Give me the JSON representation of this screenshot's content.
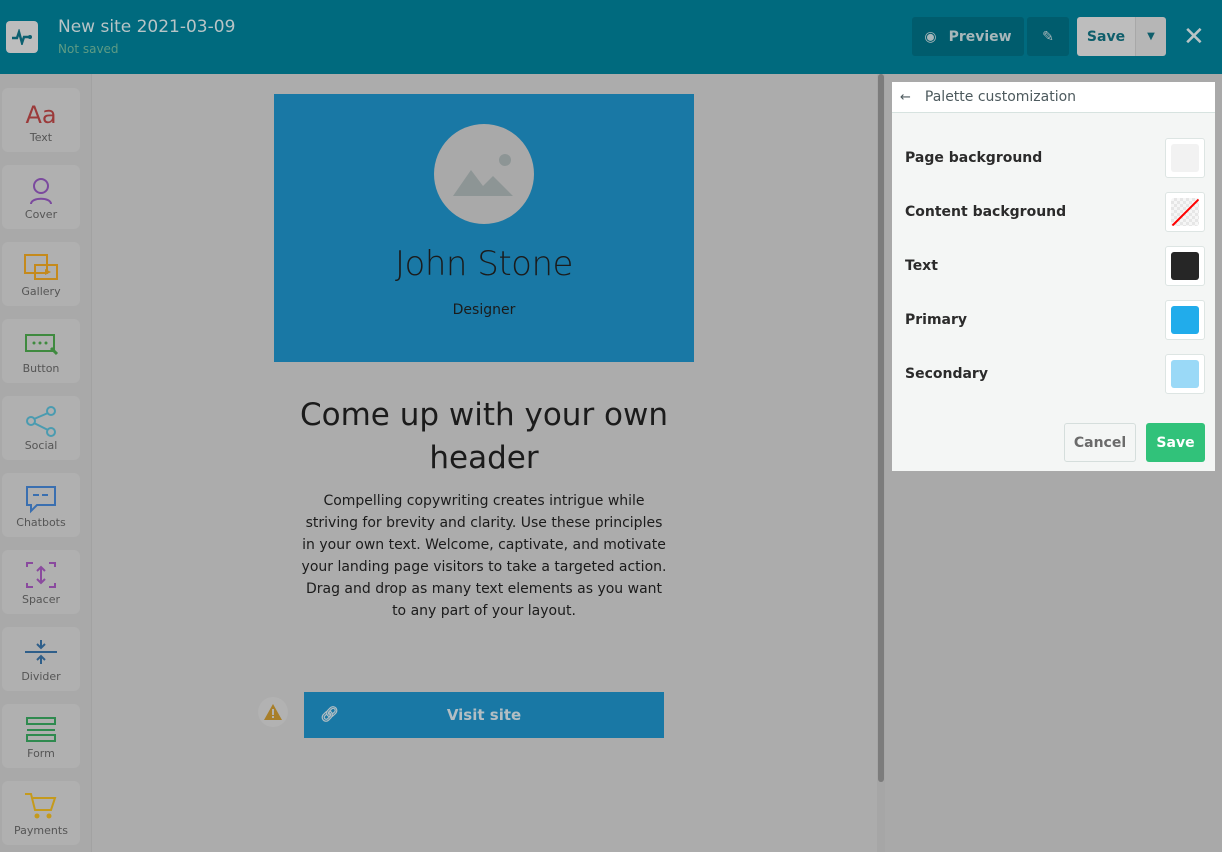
{
  "header": {
    "title": "New site 2021-03-09",
    "status": "Not saved",
    "preview_label": "Preview",
    "save_label": "Save"
  },
  "sidebar": {
    "items": [
      {
        "label": "Text",
        "color": "#9b3a3a"
      },
      {
        "label": "Cover",
        "color": "#7b4a9e"
      },
      {
        "label": "Gallery",
        "color": "#c58a1c"
      },
      {
        "label": "Button",
        "color": "#3f8a3f"
      },
      {
        "label": "Social",
        "color": "#4a9bb0"
      },
      {
        "label": "Chatbots",
        "color": "#3a6fb0"
      },
      {
        "label": "Spacer",
        "color": "#8a4a9e"
      },
      {
        "label": "Divider",
        "color": "#2f5f8a"
      },
      {
        "label": "Form",
        "color": "#2f8a4f"
      },
      {
        "label": "Payments",
        "color": "#c59a1c"
      }
    ]
  },
  "canvas": {
    "name": "John Stone",
    "role": "Designer",
    "heading": "Come up with your own header",
    "paragraph": "Compelling copywriting creates intrigue while striving for brevity and clarity. Use these principles in your own text. Welcome, captivate, and motivate your landing page visitors to take a targeted action. Drag and drop as many text elements as you want to any part of your layout.",
    "button_label": "Visit site"
  },
  "palette": {
    "title": "Palette customization",
    "cancel_label": "Cancel",
    "save_label": "Save",
    "rows": [
      {
        "label": "Page background",
        "color": "#f2f2f2"
      },
      {
        "label": "Content background",
        "color": "transparent"
      },
      {
        "label": "Text",
        "color": "#262626"
      },
      {
        "label": "Primary",
        "color": "#21aceb"
      },
      {
        "label": "Secondary",
        "color": "#9ad9f7"
      }
    ]
  }
}
